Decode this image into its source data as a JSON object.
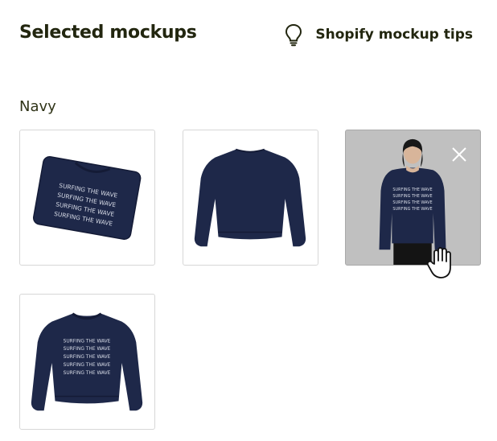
{
  "header": {
    "title": "Selected mockups",
    "tips_label": "Shopify mockup tips",
    "tips_icon": "lightbulb-icon"
  },
  "group": {
    "label": "Navy",
    "color": "#1e2849",
    "mockups": [
      {
        "view": "folded-flat",
        "print_text": "SURFING THE WAVE"
      },
      {
        "view": "back-flat"
      },
      {
        "view": "model-front",
        "print_text": "SURFING THE WAVE",
        "hovered": true
      },
      {
        "view": "front-flat",
        "print_text": "SURFING THE WAVE"
      }
    ]
  },
  "remove_icon": "close-icon",
  "cursor_icon": "hand-pointer-icon"
}
